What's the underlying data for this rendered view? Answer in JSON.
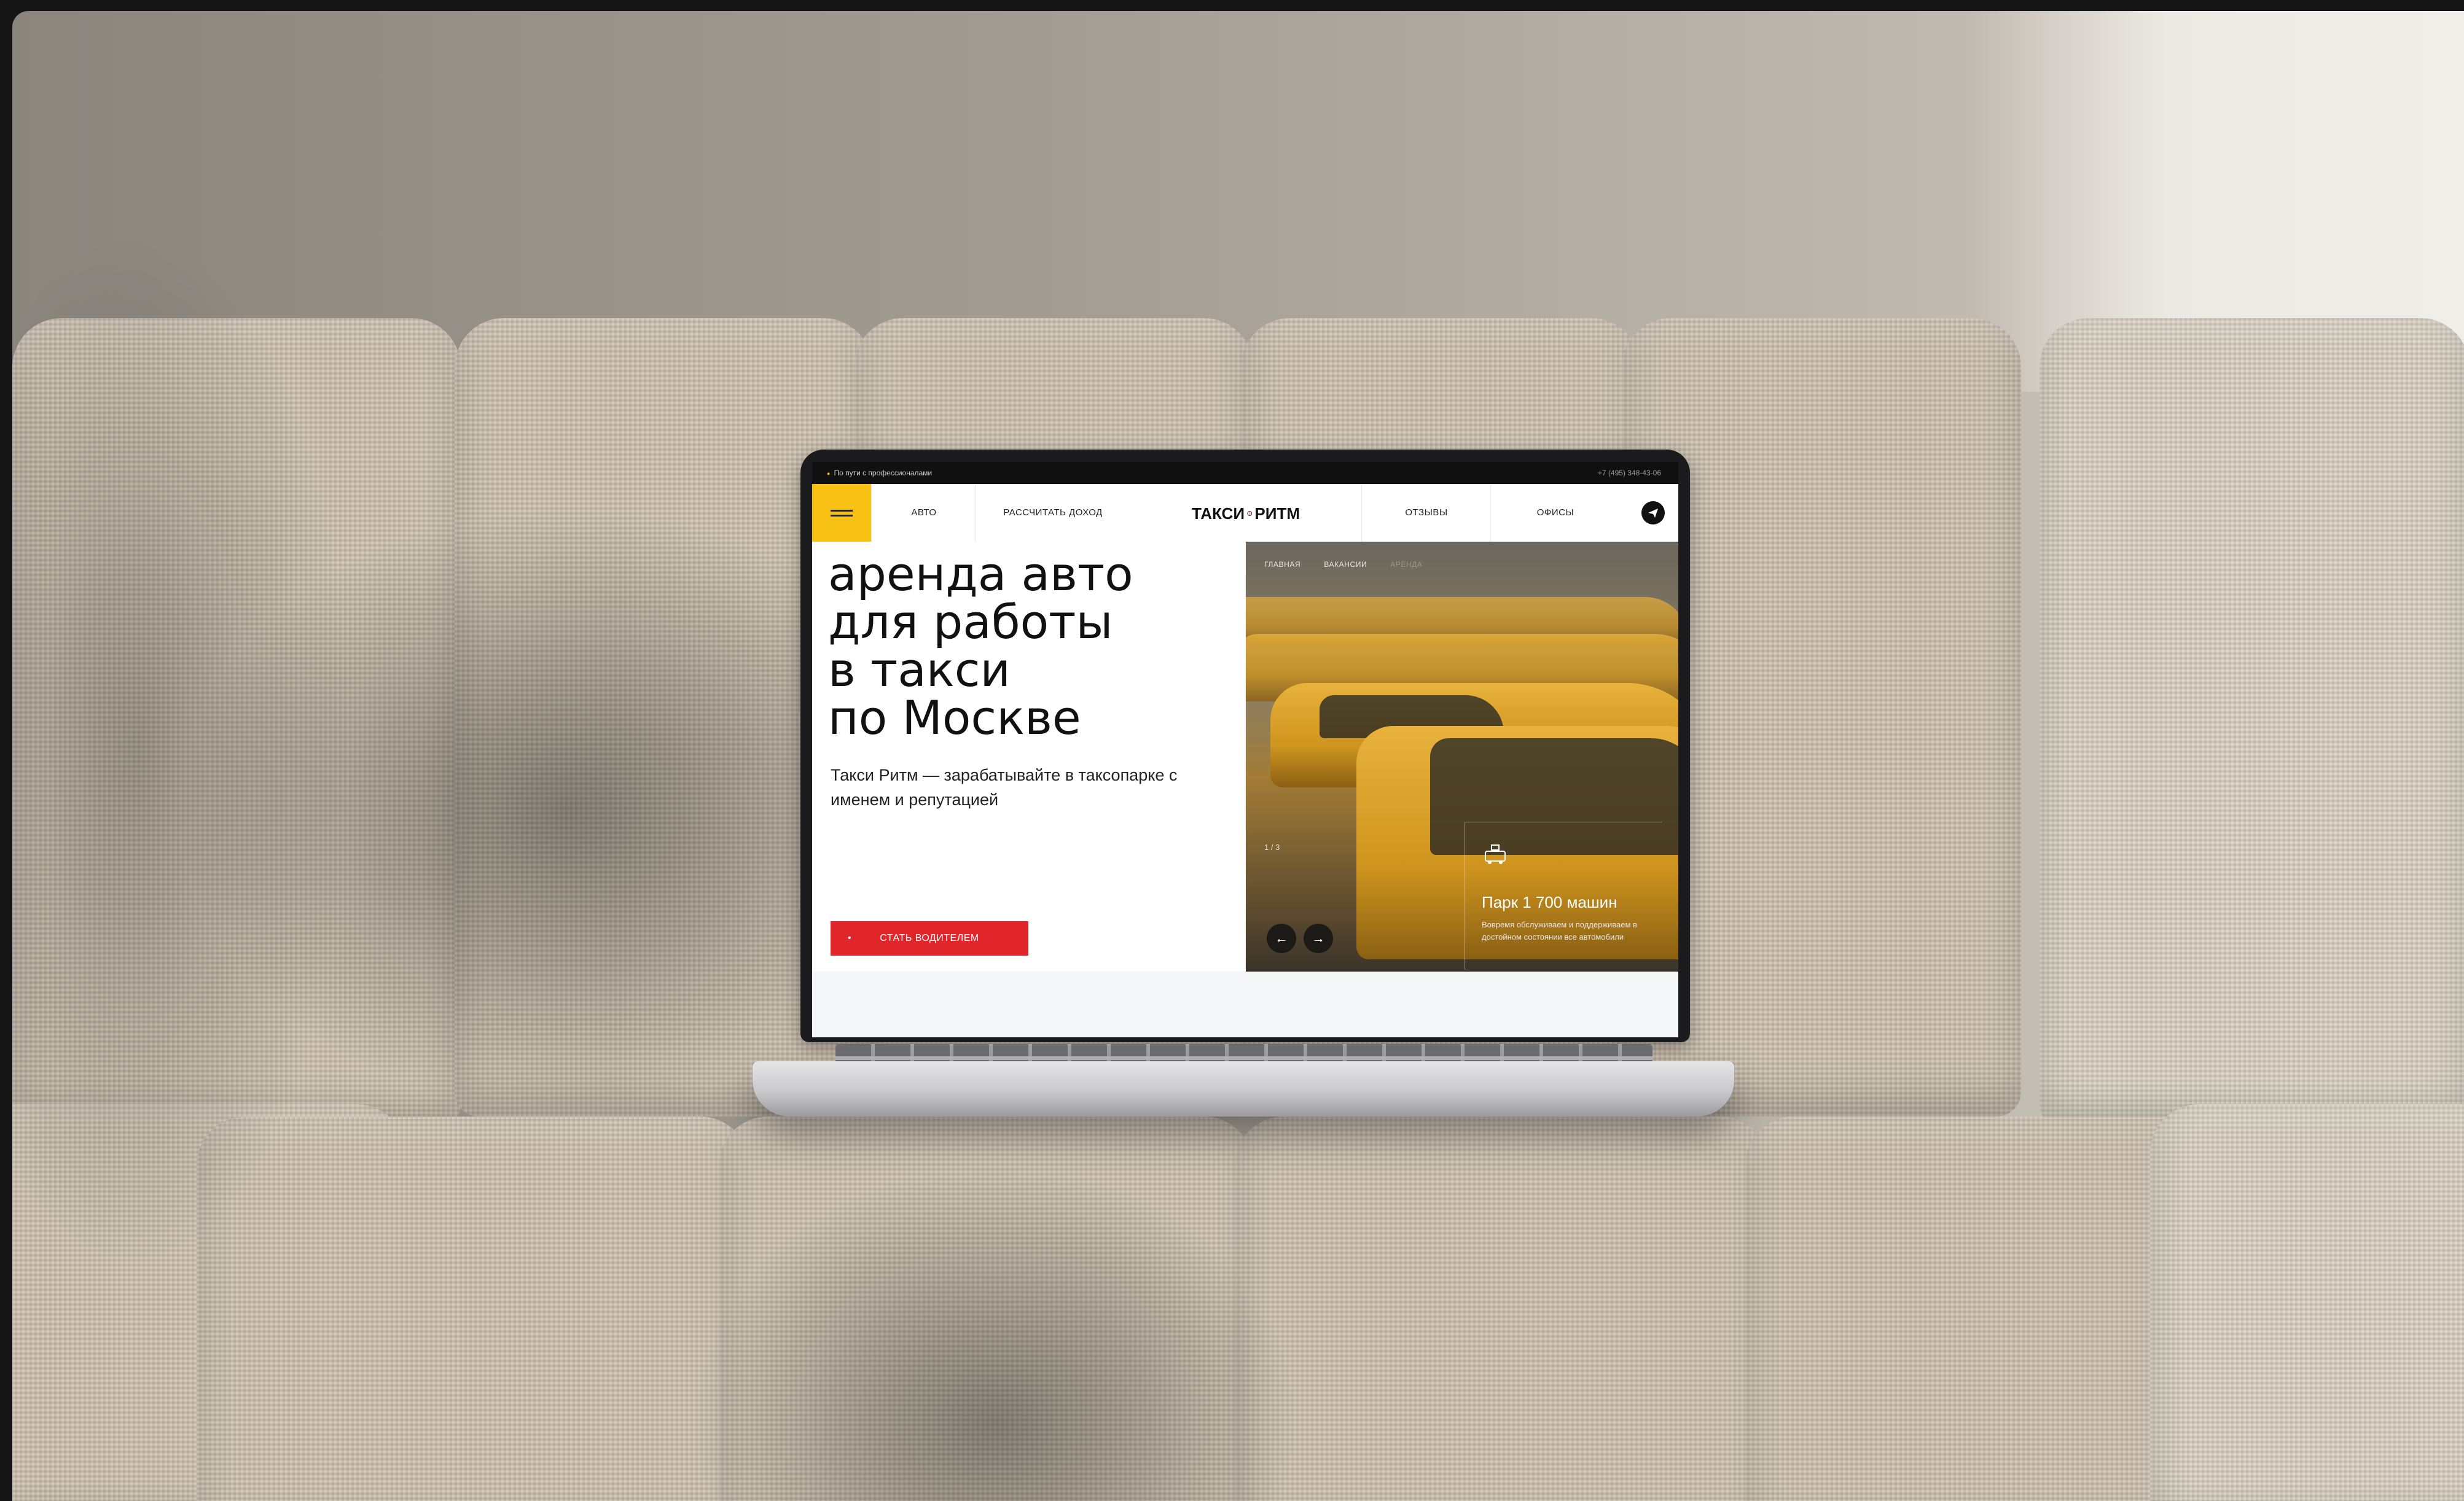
{
  "topbar": {
    "tagline": "По пути с профессионалами",
    "phone": "+7 (495) 348-43-06"
  },
  "nav": {
    "items": [
      "АВТО",
      "РАССЧИТАТЬ ДОХОД",
      "ОТЗЫВЫ",
      "ОФИСЫ"
    ],
    "logo_left": "ТАКСИ",
    "logo_right": "РИТМ"
  },
  "hero": {
    "headline": [
      "аренда авто",
      "для работы",
      "в такси",
      "по Москве"
    ],
    "subtitle": "Такси Ритм — зарабатывайте в таксопарке с именем и репутацией",
    "cta_label": "СТАТЬ ВОДИТЕЛЕМ"
  },
  "slider": {
    "breadcrumb": [
      "ГЛАВНАЯ",
      "ВАКАНСИИ",
      "АРЕНДА"
    ],
    "counter": "1 / 3",
    "title": "Парк 1 700 машин",
    "text": "Вовремя обслуживаем и поддерживаем в достойном состоянии все автомобили",
    "prev": "←",
    "next": "→"
  },
  "colors": {
    "accent_yellow": "#f7c114",
    "cta_red": "#e0262a",
    "dark": "#101010"
  },
  "icons": [
    "menu-icon",
    "send-icon",
    "taxi-icon",
    "arrow-left-icon",
    "arrow-right-icon"
  ]
}
